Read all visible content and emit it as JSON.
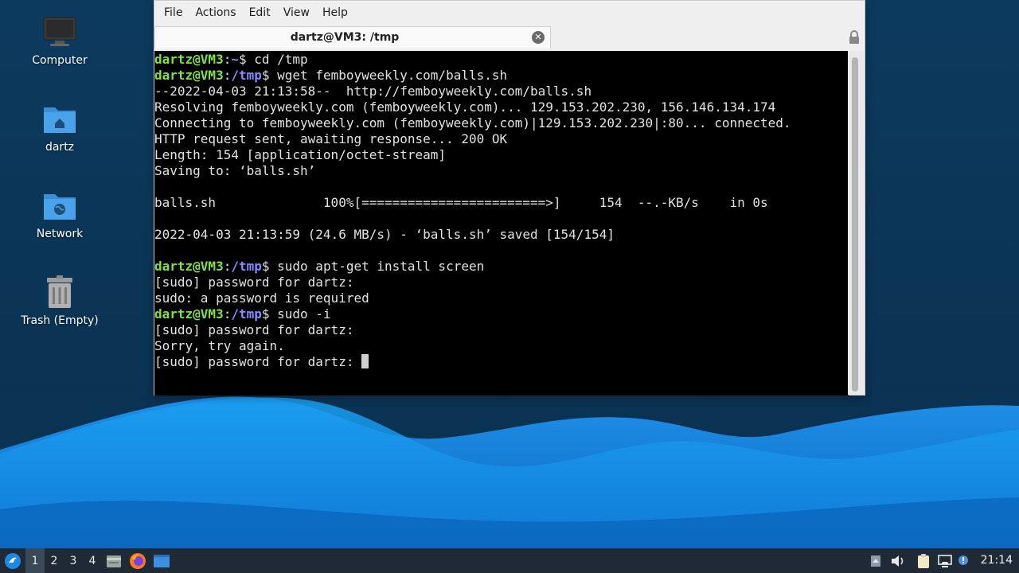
{
  "desktop": {
    "icons": [
      {
        "label": "Computer",
        "icon": "computer-icon"
      },
      {
        "label": "dartz",
        "icon": "home-folder-icon"
      },
      {
        "label": "Network",
        "icon": "network-folder-icon"
      },
      {
        "label": "Trash (Empty)",
        "icon": "trash-icon"
      }
    ]
  },
  "window": {
    "menu": [
      "File",
      "Actions",
      "Edit",
      "View",
      "Help"
    ],
    "tab_title": "dartz@VM3: /tmp",
    "tab_close_icon": "close-icon",
    "lock_icon": "lock-icon"
  },
  "terminal": {
    "lines": [
      {
        "user": "dartz@VM3",
        "colon": ":",
        "path": "~",
        "cmd": "$ cd /tmp"
      },
      {
        "user": "dartz@VM3",
        "colon": ":",
        "path": "/tmp",
        "cmd": "$ wget femboyweekly.com/balls.sh"
      },
      {
        "text": "--2022-04-03 21:13:58--  http://femboyweekly.com/balls.sh"
      },
      {
        "text": "Resolving femboyweekly.com (femboyweekly.com)... 129.153.202.230, 156.146.134.174"
      },
      {
        "text": "Connecting to femboyweekly.com (femboyweekly.com)|129.153.202.230|:80... connected."
      },
      {
        "text": "HTTP request sent, awaiting response... 200 OK"
      },
      {
        "text": "Length: 154 [application/octet-stream]"
      },
      {
        "text": "Saving to: ‘balls.sh’"
      },
      {
        "text": ""
      },
      {
        "text": "balls.sh              100%[========================>]     154  --.-KB/s    in 0s"
      },
      {
        "text": ""
      },
      {
        "text": "2022-04-03 21:13:59 (24.6 MB/s) - ‘balls.sh’ saved [154/154]"
      },
      {
        "text": ""
      },
      {
        "user": "dartz@VM3",
        "colon": ":",
        "path": "/tmp",
        "cmd": "$ sudo apt-get install screen"
      },
      {
        "text": "[sudo] password for dartz:"
      },
      {
        "text": "sudo: a password is required"
      },
      {
        "user": "dartz@VM3",
        "colon": ":",
        "path": "/tmp",
        "cmd": "$ sudo -i"
      },
      {
        "text": "[sudo] password for dartz:"
      },
      {
        "text": "Sorry, try again."
      },
      {
        "text": "[sudo] password for dartz: ",
        "cursor": true
      }
    ]
  },
  "taskbar": {
    "start_icon": "lubuntu-start-icon",
    "workspaces": [
      "1",
      "2",
      "3",
      "4"
    ],
    "active_workspace": "1",
    "launchers": [
      "file-manager-icon",
      "firefox-icon",
      "terminal-window-icon"
    ],
    "tray": [
      "tray-expand-icon",
      "volume-icon",
      "clipboard-icon",
      "network-icon",
      "update-notifier-icon"
    ],
    "clock": "21:14"
  },
  "colors": {
    "prompt_user": "#7fe243",
    "prompt_path": "#8a8aff",
    "taskbar": "#1f2a36",
    "wallpaper_dark": "#0b3557",
    "wallpaper_wave": "#1e90ff"
  }
}
